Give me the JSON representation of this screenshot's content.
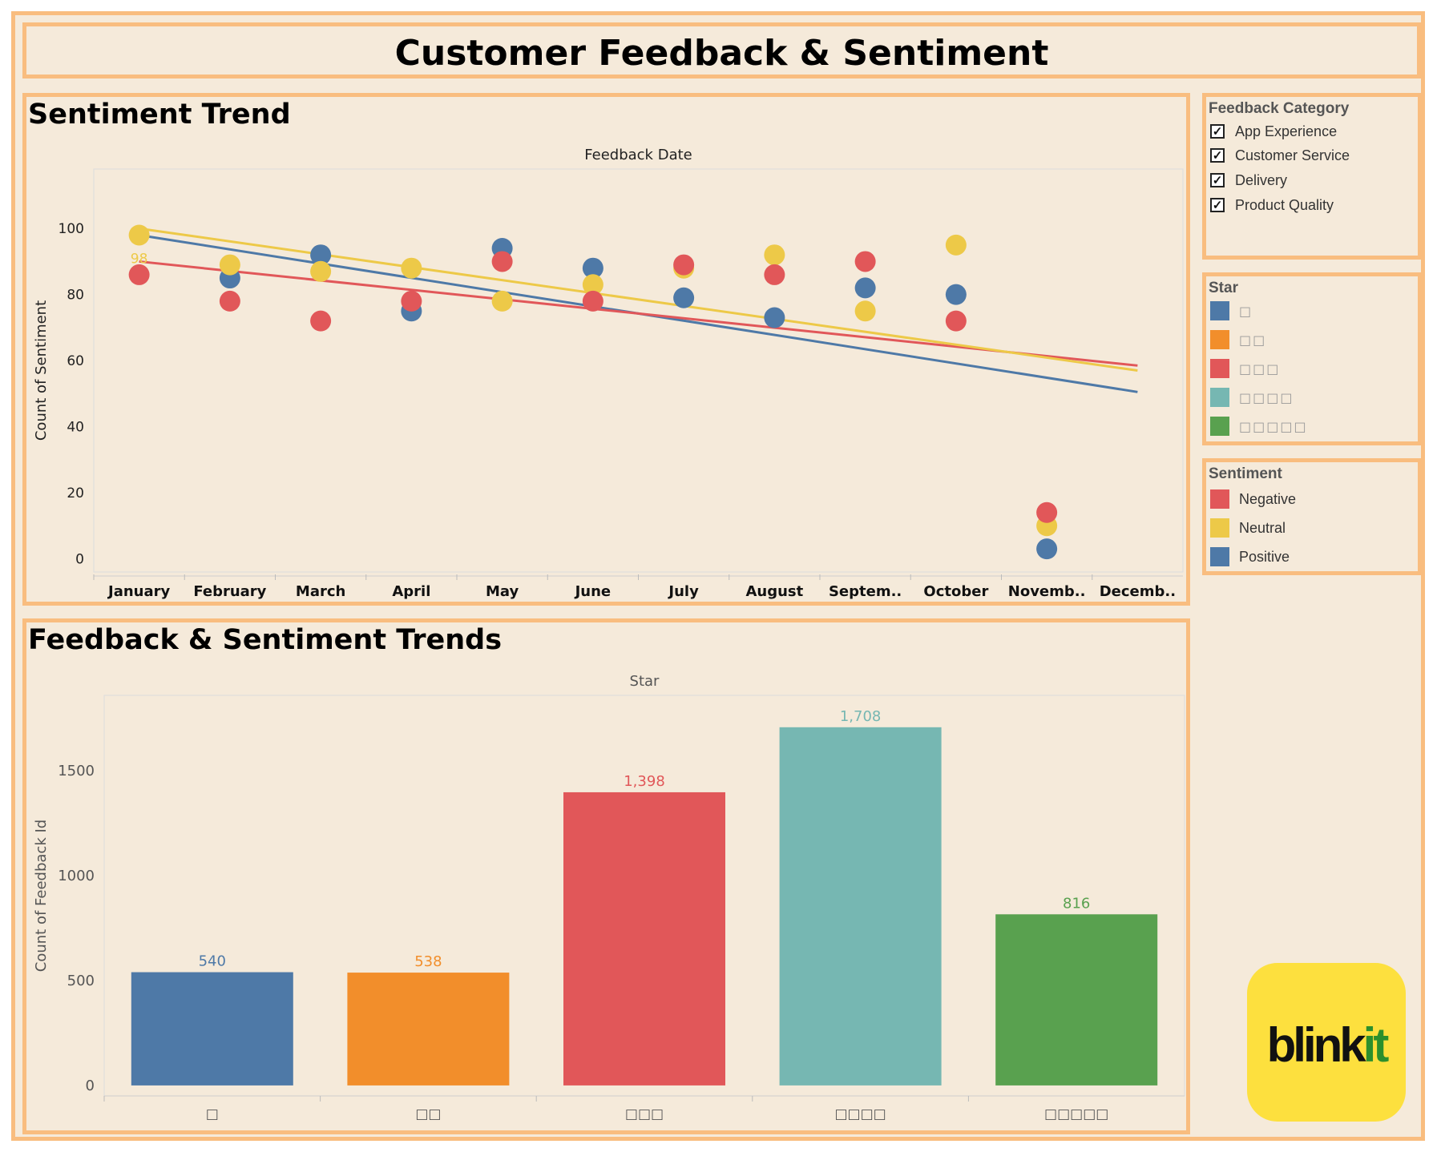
{
  "dashboard": {
    "title": "Customer Feedback & Sentiment"
  },
  "panels": {
    "trend_title": "Sentiment Trend",
    "bars_title": "Feedback & Sentiment Trends"
  },
  "filters": {
    "feedback_category": {
      "title": "Feedback Category",
      "options": [
        {
          "label": "App Experience",
          "checked": true
        },
        {
          "label": "Customer Service",
          "checked": true
        },
        {
          "label": "Delivery",
          "checked": true
        },
        {
          "label": "Product Quality",
          "checked": true
        }
      ]
    },
    "star": {
      "title": "Star",
      "items": [
        {
          "label": "□",
          "color": "#4e79a7"
        },
        {
          "label": "□□",
          "color": "#f28e2b"
        },
        {
          "label": "□□□",
          "color": "#e15759"
        },
        {
          "label": "□□□□",
          "color": "#76b7b2"
        },
        {
          "label": "□□□□□",
          "color": "#59a14f"
        }
      ]
    },
    "sentiment": {
      "title": "Sentiment",
      "items": [
        {
          "label": "Negative",
          "color": "#e15759"
        },
        {
          "label": "Neutral",
          "color": "#edc948"
        },
        {
          "label": "Positive",
          "color": "#4e79a7"
        }
      ]
    }
  },
  "logo": {
    "text_main": "blink",
    "text_accent": "it"
  },
  "chart_data": [
    {
      "type": "scatter",
      "title": "Sentiment Trend",
      "xlabel": "Feedback Date",
      "ylabel": "Count of Sentiment",
      "categories": [
        "January",
        "February",
        "March",
        "April",
        "May",
        "June",
        "July",
        "August",
        "Septem..",
        "October",
        "Novemb..",
        "Decemb.."
      ],
      "ylim": [
        -4,
        118
      ],
      "yticks": [
        0,
        20,
        40,
        60,
        80,
        100
      ],
      "series": [
        {
          "name": "Negative",
          "color": "#e15759",
          "values": [
            86,
            78,
            72,
            78,
            90,
            78,
            89,
            86,
            90,
            72,
            14,
            null
          ],
          "trend": [
            90,
            58.5
          ]
        },
        {
          "name": "Neutral",
          "color": "#edc948",
          "values": [
            98,
            89,
            87,
            88,
            78,
            83,
            88,
            92,
            75,
            95,
            10,
            null
          ],
          "trend": [
            100,
            57
          ]
        },
        {
          "name": "Positive",
          "color": "#4e79a7",
          "values": [
            null,
            85,
            92,
            75,
            94,
            88,
            79,
            73,
            82,
            80,
            3,
            null
          ],
          "trend": [
            98,
            50.5
          ]
        }
      ],
      "annotations": [
        {
          "category": "January",
          "series": "Neutral",
          "text": "98"
        }
      ],
      "grid": false
    },
    {
      "type": "bar",
      "title": "Feedback & Sentiment Trends",
      "xlabel": "Star",
      "ylabel": "Count of Feedback Id",
      "categories": [
        "□",
        "□□",
        "□□□",
        "□□□□",
        "□□□□□"
      ],
      "values": [
        540,
        538,
        1398,
        1708,
        816
      ],
      "value_labels": [
        "540",
        "538",
        "1,398",
        "1,708",
        "816"
      ],
      "colors": [
        "#4e79a7",
        "#f28e2b",
        "#e15759",
        "#76b7b2",
        "#59a14f"
      ],
      "ylim": [
        -50,
        1860
      ],
      "yticks": [
        0,
        500,
        1000,
        1500
      ],
      "grid": false
    }
  ]
}
